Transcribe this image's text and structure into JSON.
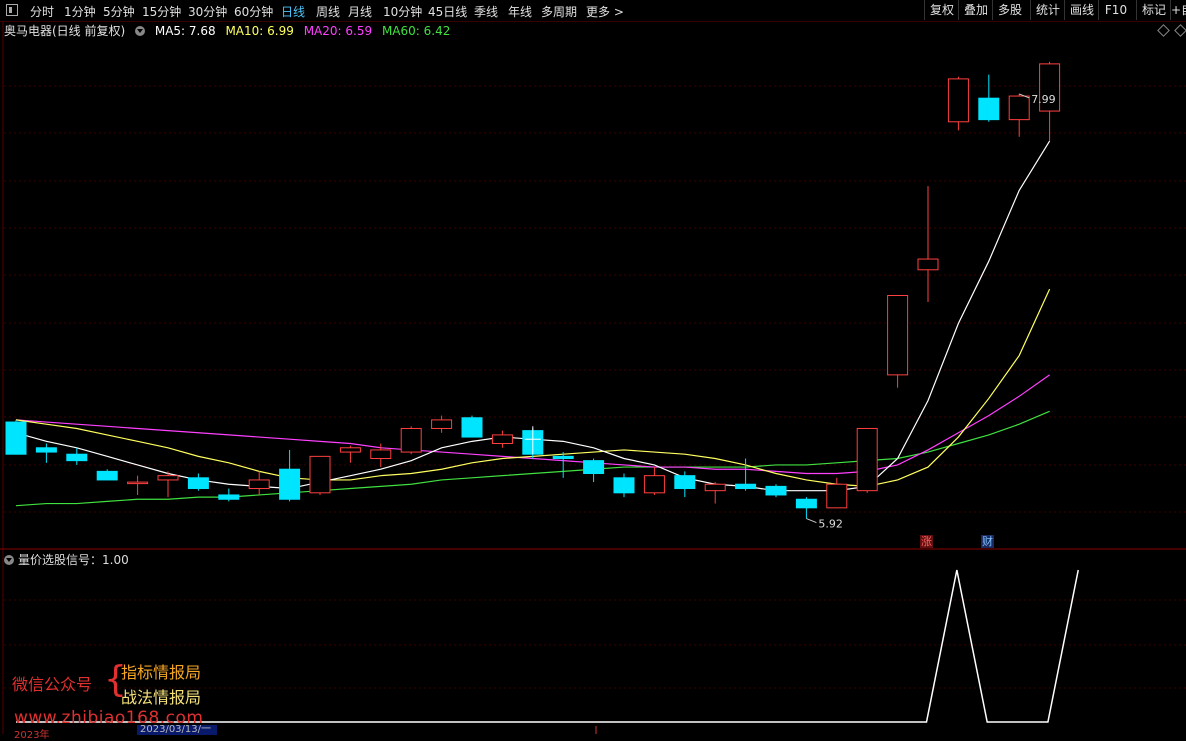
{
  "toolbar": {
    "periods": [
      {
        "label": "分时",
        "x": 30
      },
      {
        "label": "1分钟",
        "x": 64
      },
      {
        "label": "5分钟",
        "x": 103
      },
      {
        "label": "15分钟",
        "x": 142
      },
      {
        "label": "30分钟",
        "x": 188
      },
      {
        "label": "60分钟",
        "x": 234
      },
      {
        "label": "日线",
        "x": 281,
        "active": true
      },
      {
        "label": "周线",
        "x": 316
      },
      {
        "label": "月线",
        "x": 348
      },
      {
        "label": "10分钟",
        "x": 383
      },
      {
        "label": "45日线",
        "x": 428
      },
      {
        "label": "季线",
        "x": 474
      },
      {
        "label": "年线",
        "x": 508
      },
      {
        "label": "多周期",
        "x": 541
      },
      {
        "label": "更多 >",
        "x": 586
      }
    ],
    "right_buttons": [
      {
        "label": "复权",
        "x": 924,
        "w": 34
      },
      {
        "label": "叠加",
        "x": 958,
        "w": 34
      },
      {
        "label": "多股",
        "x": 992,
        "w": 34
      },
      {
        "label": "统计",
        "x": 1030,
        "w": 34
      },
      {
        "label": "画线",
        "x": 1064,
        "w": 34
      },
      {
        "label": "F10",
        "x": 1098,
        "w": 34
      },
      {
        "label": "标记",
        "x": 1136,
        "w": 34
      },
      {
        "label": "+自",
        "x": 1170,
        "w": 16
      }
    ]
  },
  "stock": {
    "name": "奥马电器(日线 前复权)",
    "ma5": "MA5: 7.68",
    "ma10": "MA10: 6.99",
    "ma20": "MA20: 6.59",
    "ma60": "MA60: 6.42"
  },
  "colors": {
    "up": "#ff4040",
    "down": "#00e5ff",
    "ma5": "#ffffff",
    "ma10": "#ffff60",
    "ma20": "#ff40ff",
    "ma60": "#40e040",
    "grid": "#3a0000"
  },
  "annotations": {
    "high": "7.99",
    "low": "5.92",
    "zhang_badge": "涨",
    "cai_badge": "财"
  },
  "chart_data": [
    {
      "type": "candlestick",
      "title": "奥马电器(日线 前复权)",
      "candles": [
        {
          "o": 6.37,
          "h": 6.38,
          "l": 6.22,
          "c": 6.22
        },
        {
          "o": 6.25,
          "h": 6.27,
          "l": 6.18,
          "c": 6.23
        },
        {
          "o": 6.22,
          "h": 6.25,
          "l": 6.17,
          "c": 6.19
        },
        {
          "o": 6.14,
          "h": 6.15,
          "l": 6.1,
          "c": 6.1
        },
        {
          "o": 6.09,
          "h": 6.12,
          "l": 6.03,
          "c": 6.09
        },
        {
          "o": 6.1,
          "h": 6.14,
          "l": 6.02,
          "c": 6.12
        },
        {
          "o": 6.11,
          "h": 6.13,
          "l": 6.05,
          "c": 6.06
        },
        {
          "o": 6.03,
          "h": 6.06,
          "l": 6.0,
          "c": 6.01
        },
        {
          "o": 6.06,
          "h": 6.14,
          "l": 6.03,
          "c": 6.1
        },
        {
          "o": 6.15,
          "h": 6.24,
          "l": 6.0,
          "c": 6.01
        },
        {
          "o": 6.04,
          "h": 6.21,
          "l": 6.03,
          "c": 6.21
        },
        {
          "o": 6.23,
          "h": 6.26,
          "l": 6.18,
          "c": 6.25
        },
        {
          "o": 6.2,
          "h": 6.27,
          "l": 6.16,
          "c": 6.24
        },
        {
          "o": 6.23,
          "h": 6.35,
          "l": 6.22,
          "c": 6.34
        },
        {
          "o": 6.34,
          "h": 6.4,
          "l": 6.32,
          "c": 6.38
        },
        {
          "o": 6.39,
          "h": 6.4,
          "l": 6.3,
          "c": 6.3
        },
        {
          "o": 6.27,
          "h": 6.33,
          "l": 6.25,
          "c": 6.31
        },
        {
          "o": 6.33,
          "h": 6.34,
          "l": 6.2,
          "c": 6.22
        },
        {
          "o": 6.21,
          "h": 6.23,
          "l": 6.11,
          "c": 6.2
        },
        {
          "o": 6.19,
          "h": 6.2,
          "l": 6.09,
          "c": 6.13
        },
        {
          "o": 6.11,
          "h": 6.13,
          "l": 6.02,
          "c": 6.04
        },
        {
          "o": 6.04,
          "h": 6.16,
          "l": 6.03,
          "c": 6.12
        },
        {
          "o": 6.12,
          "h": 6.14,
          "l": 6.02,
          "c": 6.06
        },
        {
          "o": 6.05,
          "h": 6.09,
          "l": 5.99,
          "c": 6.08
        },
        {
          "o": 6.08,
          "h": 6.2,
          "l": 6.05,
          "c": 6.06
        },
        {
          "o": 6.07,
          "h": 6.08,
          "l": 6.02,
          "c": 6.03
        },
        {
          "o": 6.01,
          "h": 6.02,
          "l": 5.92,
          "c": 5.97
        },
        {
          "o": 5.97,
          "h": 6.11,
          "l": 5.97,
          "c": 6.08
        },
        {
          "o": 6.05,
          "h": 6.34,
          "l": 6.04,
          "c": 6.34
        },
        {
          "o": 6.59,
          "h": 6.96,
          "l": 6.53,
          "c": 6.96
        },
        {
          "o": 7.08,
          "h": 7.47,
          "l": 6.93,
          "c": 7.13
        },
        {
          "o": 7.77,
          "h": 7.98,
          "l": 7.73,
          "c": 7.97
        },
        {
          "o": 7.88,
          "h": 7.99,
          "l": 7.77,
          "c": 7.78
        },
        {
          "o": 7.78,
          "h": 7.9,
          "l": 7.7,
          "c": 7.89
        },
        {
          "o": 7.82,
          "h": 8.05,
          "l": 7.68,
          "c": 8.04
        }
      ],
      "ma5": [
        6.32,
        6.28,
        6.25,
        6.21,
        6.17,
        6.13,
        6.1,
        6.08,
        6.07,
        6.06,
        6.09,
        6.12,
        6.15,
        6.19,
        6.25,
        6.28,
        6.3,
        6.29,
        6.28,
        6.25,
        6.2,
        6.17,
        6.11,
        6.08,
        6.07,
        6.05,
        6.05,
        6.05,
        6.07,
        6.2,
        6.47,
        6.83,
        7.12,
        7.45,
        7.68
      ],
      "ma10": [
        6.38,
        6.36,
        6.34,
        6.31,
        6.28,
        6.25,
        6.21,
        6.18,
        6.14,
        6.11,
        6.1,
        6.1,
        6.12,
        6.13,
        6.15,
        6.18,
        6.2,
        6.21,
        6.22,
        6.23,
        6.24,
        6.23,
        6.22,
        6.2,
        6.17,
        6.13,
        6.1,
        6.08,
        6.07,
        6.1,
        6.16,
        6.3,
        6.48,
        6.68,
        6.99
      ],
      "ma20": [
        6.38,
        6.37,
        6.36,
        6.35,
        6.34,
        6.33,
        6.32,
        6.31,
        6.3,
        6.29,
        6.28,
        6.27,
        6.25,
        6.24,
        6.23,
        6.22,
        6.21,
        6.2,
        6.19,
        6.18,
        6.17,
        6.16,
        6.16,
        6.15,
        6.15,
        6.14,
        6.13,
        6.13,
        6.14,
        6.17,
        6.24,
        6.32,
        6.4,
        6.49,
        6.59
      ],
      "ma60": [
        5.98,
        5.99,
        5.99,
        6.0,
        6.01,
        6.01,
        6.02,
        6.02,
        6.03,
        6.04,
        6.05,
        6.06,
        6.07,
        6.08,
        6.1,
        6.11,
        6.12,
        6.13,
        6.14,
        6.15,
        6.16,
        6.16,
        6.16,
        6.16,
        6.16,
        6.17,
        6.17,
        6.18,
        6.19,
        6.2,
        6.23,
        6.27,
        6.31,
        6.36,
        6.42
      ]
    },
    {
      "type": "line",
      "title": "量价选股信号",
      "value_label": "量价选股信号：1.00",
      "values": [
        0,
        0,
        0,
        0,
        0,
        0,
        0,
        0,
        0,
        0,
        0,
        0,
        0,
        0,
        0,
        0,
        0,
        0,
        0,
        0,
        0,
        0,
        0,
        0,
        0,
        0,
        0,
        0,
        0,
        0,
        0,
        1,
        0,
        0,
        0,
        1
      ],
      "ylim": [
        0,
        1
      ]
    }
  ],
  "watermark": {
    "wechat": "微信公众号",
    "brace": "{",
    "line1": "指标情报局",
    "line2": "战法情报局",
    "url": "www.zhibiao168.com"
  },
  "dates": {
    "left": "2023年",
    "cursor": "2023/03/13/一"
  }
}
